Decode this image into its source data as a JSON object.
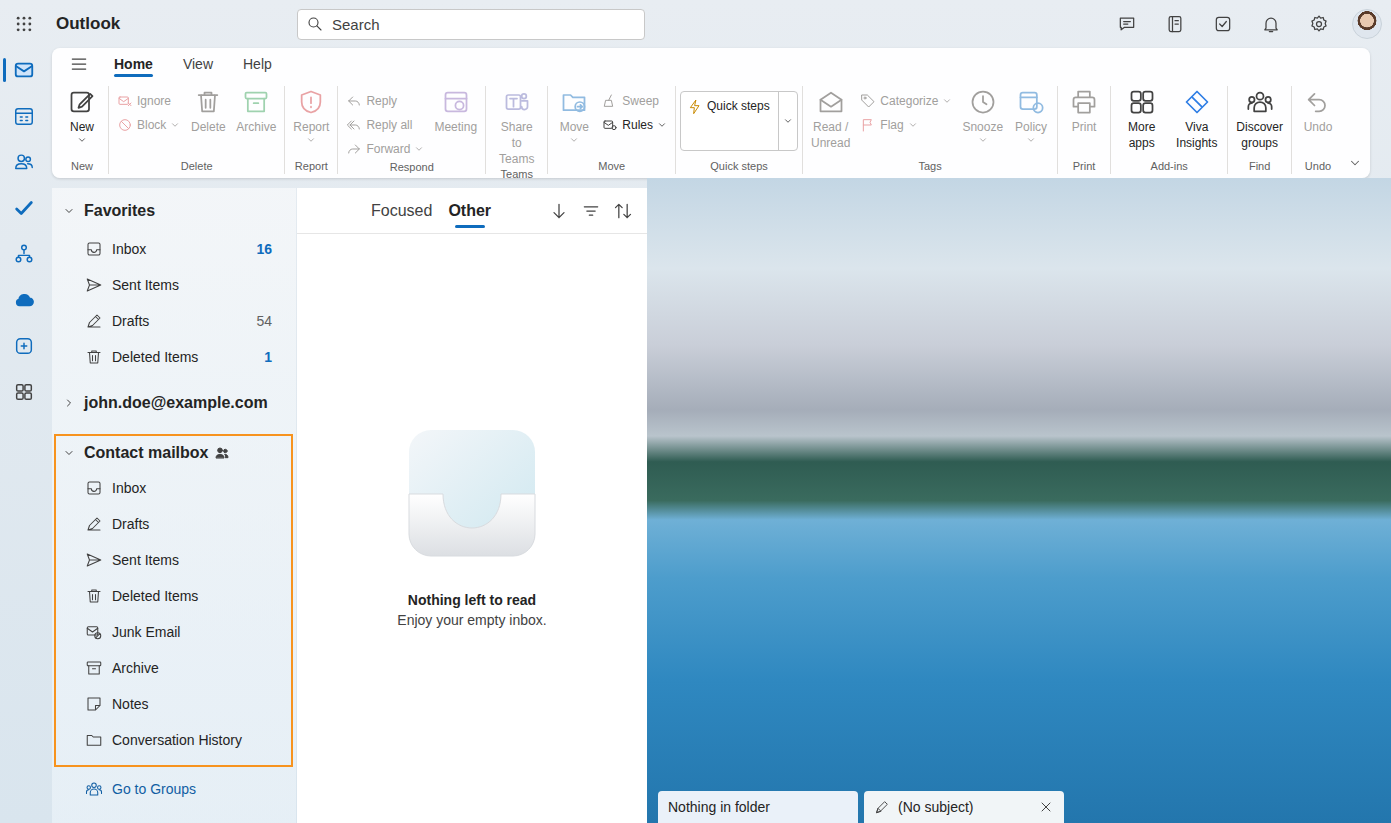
{
  "app": {
    "title": "Outlook"
  },
  "search": {
    "placeholder": "Search"
  },
  "rail": [
    {
      "selected": true
    },
    {
      "selected": false
    },
    {
      "selected": false
    },
    {
      "selected": false
    },
    {
      "selected": false
    },
    {
      "selected": false
    },
    {
      "selected": false
    },
    {
      "selected": false
    }
  ],
  "ribbon": {
    "tabs": [
      {
        "label": "Home",
        "selected": true
      },
      {
        "label": "View",
        "selected": false
      },
      {
        "label": "Help",
        "selected": false
      }
    ],
    "groups": [
      {
        "label": "New",
        "commands": [
          {
            "label": "New",
            "kind": "large",
            "disabled": false,
            "menu": true
          }
        ]
      },
      {
        "label": "Delete",
        "commands": [
          {
            "label": "Ignore",
            "kind": "small",
            "disabled": true,
            "menu": false
          },
          {
            "label": "Block",
            "kind": "small",
            "disabled": true,
            "menu": true
          },
          {
            "label": "Delete",
            "kind": "large",
            "disabled": true,
            "menu": false
          },
          {
            "label": "Archive",
            "kind": "large",
            "disabled": true,
            "menu": false
          }
        ]
      },
      {
        "label": "Report",
        "commands": [
          {
            "label": "Report",
            "kind": "large",
            "disabled": true,
            "menu": true
          }
        ]
      },
      {
        "label": "Respond",
        "commands": [
          {
            "label": "Reply",
            "kind": "small",
            "disabled": true,
            "menu": false
          },
          {
            "label": "Reply all",
            "kind": "small",
            "disabled": true,
            "menu": false
          },
          {
            "label": "Forward",
            "kind": "small",
            "disabled": true,
            "menu": true
          },
          {
            "label": "Meeting",
            "kind": "large",
            "disabled": true,
            "menu": false
          }
        ]
      },
      {
        "label": "Teams",
        "commands": [
          {
            "label": "Share to Teams",
            "kind": "large",
            "disabled": true,
            "menu": false
          }
        ]
      },
      {
        "label": "Move",
        "commands": [
          {
            "label": "Move",
            "kind": "large",
            "disabled": true,
            "menu": true
          },
          {
            "label": "Sweep",
            "kind": "small",
            "disabled": true,
            "menu": false
          },
          {
            "label": "Rules",
            "kind": "small",
            "disabled": false,
            "menu": true
          }
        ]
      },
      {
        "label": "Quick steps",
        "commands": [
          {
            "label": "Quick steps",
            "kind": "quickstep",
            "disabled": false,
            "menu": true
          }
        ]
      },
      {
        "label": "Tags",
        "commands": [
          {
            "label": "Read / Unread",
            "kind": "large",
            "disabled": true,
            "menu": false
          },
          {
            "label": "Categorize",
            "kind": "small",
            "disabled": true,
            "menu": true
          },
          {
            "label": "Flag",
            "kind": "small",
            "disabled": true,
            "menu": true
          },
          {
            "label": "Snooze",
            "kind": "large",
            "disabled": true,
            "menu": true
          },
          {
            "label": "Policy",
            "kind": "large",
            "disabled": true,
            "menu": true
          }
        ]
      },
      {
        "label": "Print",
        "commands": [
          {
            "label": "Print",
            "kind": "large",
            "disabled": true,
            "menu": false
          }
        ]
      },
      {
        "label": "Add-ins",
        "commands": [
          {
            "label": "More apps",
            "kind": "large",
            "disabled": false,
            "menu": false
          },
          {
            "label": "Viva Insights",
            "kind": "large",
            "disabled": false,
            "menu": false
          }
        ]
      },
      {
        "label": "Find",
        "commands": [
          {
            "label": "Discover groups",
            "kind": "large",
            "disabled": false,
            "menu": false
          }
        ]
      },
      {
        "label": "Undo",
        "commands": [
          {
            "label": "Undo",
            "kind": "large",
            "disabled": true,
            "menu": false
          }
        ]
      }
    ]
  },
  "folder_pane": {
    "sections": [
      {
        "label": "Favorites",
        "expanded": true,
        "shared": false,
        "highlighted": false,
        "items": [
          {
            "label": "Inbox",
            "count": "16",
            "unread": true
          },
          {
            "label": "Sent Items"
          },
          {
            "label": "Drafts",
            "count": "54",
            "unread": false
          },
          {
            "label": "Deleted Items",
            "count": "1",
            "unread": true
          }
        ]
      },
      {
        "label": "john.doe@example.com",
        "expanded": false,
        "shared": false,
        "highlighted": false,
        "items": []
      },
      {
        "label": "Contact mailbox",
        "expanded": true,
        "shared": true,
        "highlighted": true,
        "items": [
          {
            "label": "Inbox"
          },
          {
            "label": "Drafts"
          },
          {
            "label": "Sent Items"
          },
          {
            "label": "Deleted Items"
          },
          {
            "label": "Junk Email"
          },
          {
            "label": "Archive"
          },
          {
            "label": "Notes"
          },
          {
            "label": "Conversation History"
          }
        ]
      }
    ],
    "footer_link": {
      "label": "Go to Groups"
    }
  },
  "message_list": {
    "tabs": [
      {
        "label": "Focused",
        "selected": false
      },
      {
        "label": "Other",
        "selected": true
      }
    ],
    "empty": {
      "title": "Nothing left to read",
      "subtitle": "Enjoy your empty inbox."
    }
  },
  "bottom_tabs": [
    {
      "label": "Nothing in folder",
      "kind": "status"
    },
    {
      "label": "(No subject)",
      "kind": "draft"
    }
  ]
}
